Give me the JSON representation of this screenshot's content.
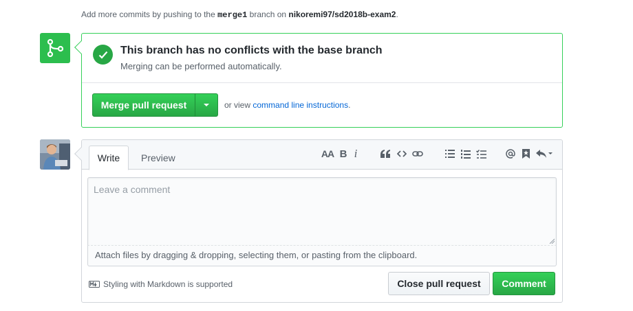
{
  "hint": {
    "prefix": "Add more commits by pushing to the",
    "branch": "merge1",
    "middle": "branch on",
    "repo": "nikoremi97/sd2018b-exam2",
    "suffix": "."
  },
  "merge": {
    "icon": "git-merge-icon",
    "status_title": "This branch has no conflicts with the base branch",
    "status_sub": "Merging can be performed automatically.",
    "merge_button_label": "Merge pull request",
    "or_view_text": "or view",
    "command_line_link": "command line instructions",
    "or_view_suffix": "."
  },
  "comment": {
    "tabs": [
      {
        "label": "Write",
        "active": true
      },
      {
        "label": "Preview",
        "active": false
      }
    ],
    "toolbar": {
      "heading_label": "AA",
      "bold_label": "B",
      "italic_label": "i",
      "icons": [
        "heading-icon",
        "bold-icon",
        "italic-icon",
        "quote-icon",
        "code-icon",
        "link-icon",
        "unordered-list-icon",
        "ordered-list-icon",
        "task-list-icon",
        "mention-icon",
        "bookmark-icon",
        "reply-icon"
      ]
    },
    "placeholder": "Leave a comment",
    "attach_text": "Attach files by dragging & dropping, selecting them, or pasting from the clipboard.",
    "markdown_note": "Styling with Markdown is supported",
    "close_button_label": "Close pull request",
    "comment_button_label": "Comment"
  },
  "colors": {
    "accent_green": "#2cbe4e",
    "link_blue": "#0366d6"
  }
}
